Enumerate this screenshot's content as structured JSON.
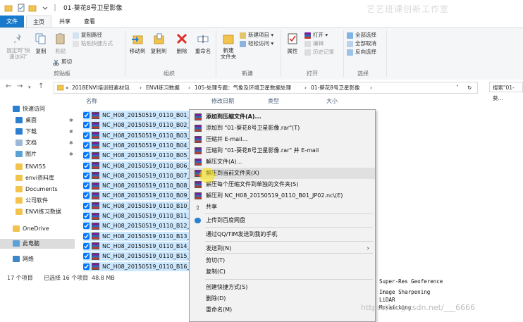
{
  "window": {
    "title": "01-葵花8号卫星影像"
  },
  "watermark_top": "艺艺班课创新工作室",
  "tabs": [
    "文件",
    "主页",
    "共享",
    "查看"
  ],
  "ribbon": {
    "clipboard": {
      "pin_label": "固定到\"快\n速访问\"",
      "copy_label": "复制",
      "paste_label": "粘贴",
      "copy_path": "复制路径",
      "paste_shortcut": "粘贴快捷方式",
      "cut": "剪切",
      "group": "剪贴板"
    },
    "organize": {
      "move_to": "移动到",
      "copy_to": "复制到",
      "delete": "删除",
      "rename": "重命名",
      "group": "组织"
    },
    "new": {
      "new_folder": "新建\n文件夹",
      "new_item": "新建项目",
      "easy_access": "轻松访问",
      "group": "新建"
    },
    "open": {
      "properties": "属性",
      "open": "打开",
      "edit": "编辑",
      "history": "历史记录",
      "group": "打开"
    },
    "select": {
      "select_all": "全部选择",
      "select_none": "全部取消",
      "invert": "反向选择",
      "group": "选择"
    }
  },
  "address": {
    "segments": [
      "2018ENVI培训班素材包",
      "ENVI练习数据",
      "105-处理专题：气象及环境卫星数据处理",
      "01-葵花8号卫星影像"
    ],
    "search_placeholder": "搜索\"01-葵..."
  },
  "nav": {
    "items": [
      {
        "label": "快速访问"
      },
      {
        "label": "桌面"
      },
      {
        "label": "下载"
      },
      {
        "label": "文档"
      },
      {
        "label": "图片"
      },
      {
        "label": "ENVI55"
      },
      {
        "label": "envi资料库"
      },
      {
        "label": "Documents"
      },
      {
        "label": "公司软件"
      },
      {
        "label": "ENVI练习数据"
      },
      {
        "label": "OneDrive"
      },
      {
        "label": "此电脑"
      },
      {
        "label": "网络"
      }
    ]
  },
  "columns": {
    "name": "名称",
    "modified": "修改日期",
    "type": "类型",
    "size": "大小"
  },
  "files": [
    "NC_H08_20150519_0110_B01_JP02.nc",
    "NC_H08_20150519_0110_B02_JP02.nc",
    "NC_H08_20150519_0110_B03_JP02.nc",
    "NC_H08_20150519_0110_B04_JP02.nc",
    "NC_H08_20150519_0110_B05_JP02.nc",
    "NC_H08_20150519_0110_B06_JP02.nc",
    "NC_H08_20150519_0110_B07_JP02.nc",
    "NC_H08_20150519_0110_B08_JP02.nc",
    "NC_H08_20150519_0110_B09_JP02.nc",
    "NC_H08_20150519_0110_B10_JP02.nc",
    "NC_H08_20150519_0110_B11_JP02.nc",
    "NC_H08_20150519_0110_B12_JP02.nc",
    "NC_H08_20150519_0110_B13_JP02.nc",
    "NC_H08_20150519_0110_B14_JP02.nc",
    "NC_H08_20150519_0110_B15_JP02.nc",
    "NC_H08_20150519_0110_B16_JP02.nc"
  ],
  "status": {
    "count": "17 个项目",
    "selected": "已选择 16 个项目",
    "size": "48.8 MB"
  },
  "context_menu": [
    {
      "label": "添加到压缩文件(A)...",
      "bold": true
    },
    {
      "label": "添加到 \"01-葵花8号卫星影像.rar\"(T)"
    },
    {
      "label": "压缩并 E-mail..."
    },
    {
      "label": "压缩到 \"01-葵花8号卫星影像.rar\" 并 E-mail"
    },
    {
      "label": "解压文件(A)..."
    },
    {
      "label": "解压到当前文件夹(X)",
      "highlight": true
    },
    {
      "label": "解压每个压缩文件到单独的文件夹(S)"
    },
    {
      "label": "解压到 NC_H08_20150519_0110_B01_JP02.nc\\(E)"
    },
    {
      "label": "共享"
    },
    {
      "label": "上传到百度网盘"
    },
    {
      "label": "通过QQ/TIM发送到我的手机"
    },
    {
      "label": "发送到(N)",
      "submenu": true
    },
    {
      "label": "剪切(T)"
    },
    {
      "label": "复制(C)"
    },
    {
      "label": "创建快捷方式(S)"
    },
    {
      "label": "删除(D)"
    },
    {
      "label": "重命名(M)"
    }
  ],
  "code_lines": [
    "Super-Res Geoference",
    "Image Sharpening",
    "LiDAR",
    "Mosaicking"
  ],
  "watermark_bottom": "https://blog.csdn.net/___6666"
}
